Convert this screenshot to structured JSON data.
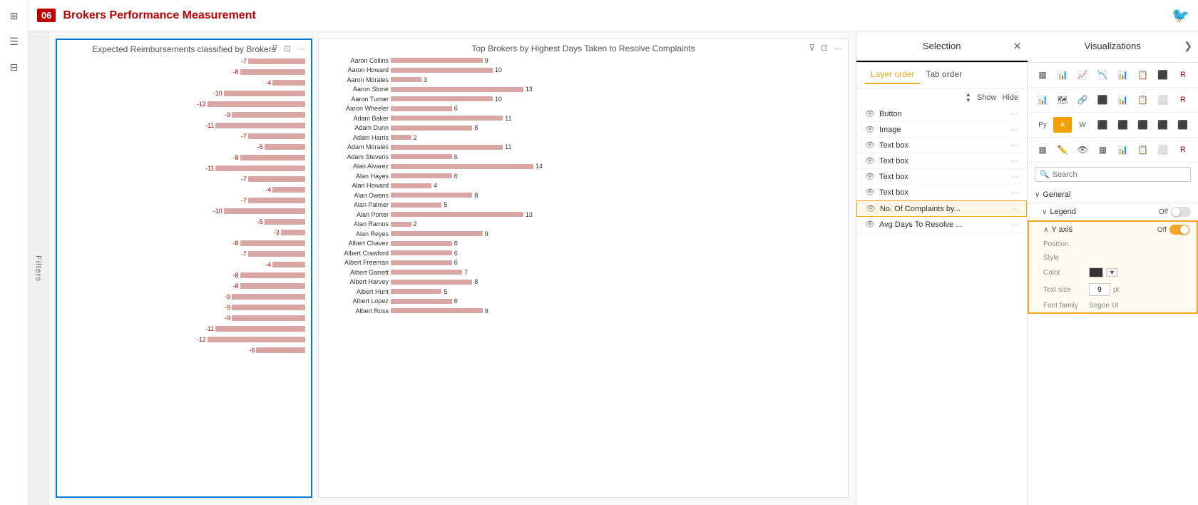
{
  "header": {
    "page_num": "06",
    "title": "Brokers Performance Measurement",
    "bird_icon": "🐦"
  },
  "left_sidebar": {
    "icons": [
      "⊞",
      "☰",
      "⊟"
    ]
  },
  "filters_panel": {
    "label": "Filters"
  },
  "chart_left": {
    "title": "Expected Reimbursements classified by Brokers",
    "bars": [
      {
        "value": -7
      },
      {
        "value": -8
      },
      {
        "value": -4
      },
      {
        "value": -10
      },
      {
        "value": -12
      },
      {
        "value": -9
      },
      {
        "value": -11
      },
      {
        "value": -7
      },
      {
        "value": -5
      },
      {
        "value": -8
      },
      {
        "value": -11
      },
      {
        "value": -7
      },
      {
        "value": -4
      },
      {
        "value": -7
      },
      {
        "value": -10
      },
      {
        "value": -5
      },
      {
        "value": -3
      },
      {
        "value": -8
      },
      {
        "value": -7
      },
      {
        "value": -4
      },
      {
        "value": -8
      },
      {
        "value": -8
      },
      {
        "value": -9
      },
      {
        "value": -9
      },
      {
        "value": -9
      },
      {
        "value": -11
      },
      {
        "value": -12
      },
      {
        "value": -6
      }
    ]
  },
  "chart_right": {
    "title": "Top Brokers by Highest Days Taken to Resolve Complaints",
    "brokers": [
      {
        "name": "Aaron Collins",
        "value": 9
      },
      {
        "name": "Aaron Howard",
        "value": 10
      },
      {
        "name": "Aaron Morales",
        "value": 3
      },
      {
        "name": "Aaron Stone",
        "value": 13
      },
      {
        "name": "Aaron Turner",
        "value": 10
      },
      {
        "name": "Aaron Wheeler",
        "value": 6
      },
      {
        "name": "Adam Baker",
        "value": 11
      },
      {
        "name": "Adam Dunn",
        "value": 8
      },
      {
        "name": "Adam Harris",
        "value": 2
      },
      {
        "name": "Adam Morales",
        "value": 11
      },
      {
        "name": "Adam Stevens",
        "value": 6
      },
      {
        "name": "Alan Alvarez",
        "value": 14
      },
      {
        "name": "Alan Hayes",
        "value": 6
      },
      {
        "name": "Alan Howard",
        "value": 4
      },
      {
        "name": "Alan Owens",
        "value": 8
      },
      {
        "name": "Alan Palmer",
        "value": 5
      },
      {
        "name": "Alan Porter",
        "value": 13
      },
      {
        "name": "Alan Ramos",
        "value": 2
      },
      {
        "name": "Alan Reyes",
        "value": 9
      },
      {
        "name": "Albert Chavez",
        "value": 6
      },
      {
        "name": "Albert Crawford",
        "value": 6
      },
      {
        "name": "Albert Freeman",
        "value": 6
      },
      {
        "name": "Albert Garrett",
        "value": 7
      },
      {
        "name": "Albert Harvey",
        "value": 8
      },
      {
        "name": "Albert Hunt",
        "value": 5
      },
      {
        "name": "Albert Lopez",
        "value": 6
      },
      {
        "name": "Albert Ross",
        "value": 9
      }
    ]
  },
  "selection_panel": {
    "title": "Selection",
    "close_icon": "✕",
    "tabs": [
      {
        "label": "Layer order",
        "active": true
      },
      {
        "label": "Tab order",
        "active": false
      }
    ],
    "show_label": "Show",
    "hide_label": "Hide",
    "layers": [
      {
        "label": "Button",
        "visible": true
      },
      {
        "label": "Image",
        "visible": true
      },
      {
        "label": "Text box",
        "visible": true
      },
      {
        "label": "Text box",
        "visible": true
      },
      {
        "label": "Text box",
        "visible": true
      },
      {
        "label": "Text box",
        "visible": true
      },
      {
        "label": "No. Of Complaints by...",
        "visible": true,
        "highlighted": true
      },
      {
        "label": "Avg Days To Resolve ...",
        "visible": true
      }
    ]
  },
  "visualizations_panel": {
    "title": "Visualizations",
    "chevron_left": "❮",
    "chevron_right": "❯",
    "search_placeholder": "Search",
    "icon_rows": [
      [
        "▦",
        "📊",
        "📈",
        "📉",
        "📊",
        "📋",
        "⬛",
        "R"
      ],
      [
        "📊",
        "🗺️",
        "🔗",
        "⬛",
        "📊",
        "📋",
        "⬜",
        "R"
      ],
      [
        "Py",
        "⬛",
        "W",
        "⬛",
        "⬛",
        "⬛",
        "⬛",
        "⬛"
      ],
      [
        "▦",
        "✏️",
        "👁️",
        "▦",
        "📊",
        "📋",
        "⬜",
        "R"
      ]
    ],
    "properties": {
      "general": {
        "label": "General",
        "expanded": true
      },
      "legend": {
        "label": "Legend",
        "toggle": "Off"
      },
      "y_axis": {
        "label": "Y axis",
        "toggle": "Off",
        "highlighted": true,
        "position_label": "Position",
        "font_style_label": "Style",
        "color_label": "Color",
        "text_size_label": "Text size",
        "text_size_value": "9",
        "text_size_unit": "pt",
        "font_family_label": "Font family",
        "font_family_value": "Segoe UI"
      }
    }
  }
}
